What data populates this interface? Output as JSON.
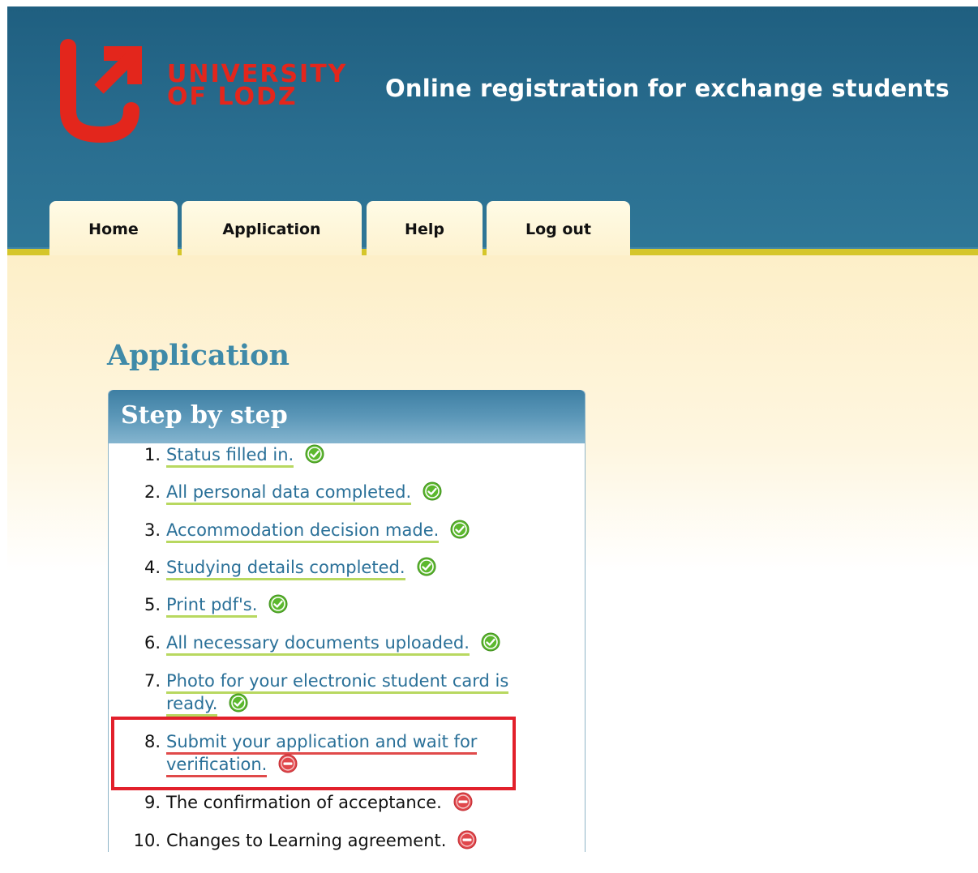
{
  "header": {
    "logo_line1": "UNIVERSITY",
    "logo_line2": "OF LODZ",
    "site_title": "Online registration for exchange students"
  },
  "tabs": [
    {
      "label": "Home"
    },
    {
      "label": "Application"
    },
    {
      "label": "Help"
    },
    {
      "label": "Log out"
    }
  ],
  "page": {
    "heading": "Application",
    "panel_title": "Step by step"
  },
  "steps": [
    {
      "num": "1.",
      "text": "Status filled in.",
      "done": true
    },
    {
      "num": "2.",
      "text": "All personal data completed.",
      "done": true
    },
    {
      "num": "3.",
      "text": "Accommodation decision made.",
      "done": true
    },
    {
      "num": "4.",
      "text": "Studying details completed.",
      "done": true
    },
    {
      "num": "5.",
      "text": "Print pdf's.",
      "done": true
    },
    {
      "num": "6.",
      "text": "All necessary documents uploaded.",
      "done": true
    },
    {
      "num": "7.",
      "text_line1": "Photo for your electronic student card is",
      "text_line2": "ready.",
      "done": true
    },
    {
      "num": "8.",
      "text_line1": "Submit your application and wait for",
      "text_line2": "verification.",
      "done": false
    },
    {
      "num": "9.",
      "text": "The confirmation of acceptance.",
      "done": false
    },
    {
      "num": "10.",
      "text": "Changes to Learning agreement.",
      "done": false
    }
  ],
  "colors": {
    "brand_red": "#e3261c",
    "header_blue": "#2a6e90",
    "accent_yellow": "#d5c62b",
    "link_blue": "#2a7098",
    "done_green": "#5cb82e",
    "pending_red": "#e0474c"
  },
  "icons": {
    "done": "check-circle-icon",
    "pending": "minus-circle-icon"
  }
}
